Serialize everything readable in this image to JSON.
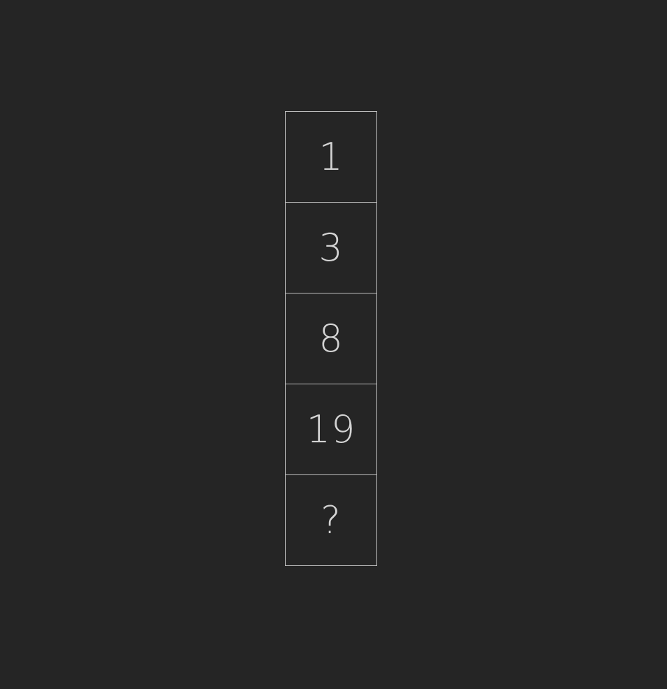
{
  "sequence": {
    "cells": [
      "1",
      "3",
      "8",
      "19",
      "?"
    ]
  },
  "colors": {
    "background": "#252525",
    "border": "#bdbdbd",
    "text": "#d4d4d4"
  }
}
